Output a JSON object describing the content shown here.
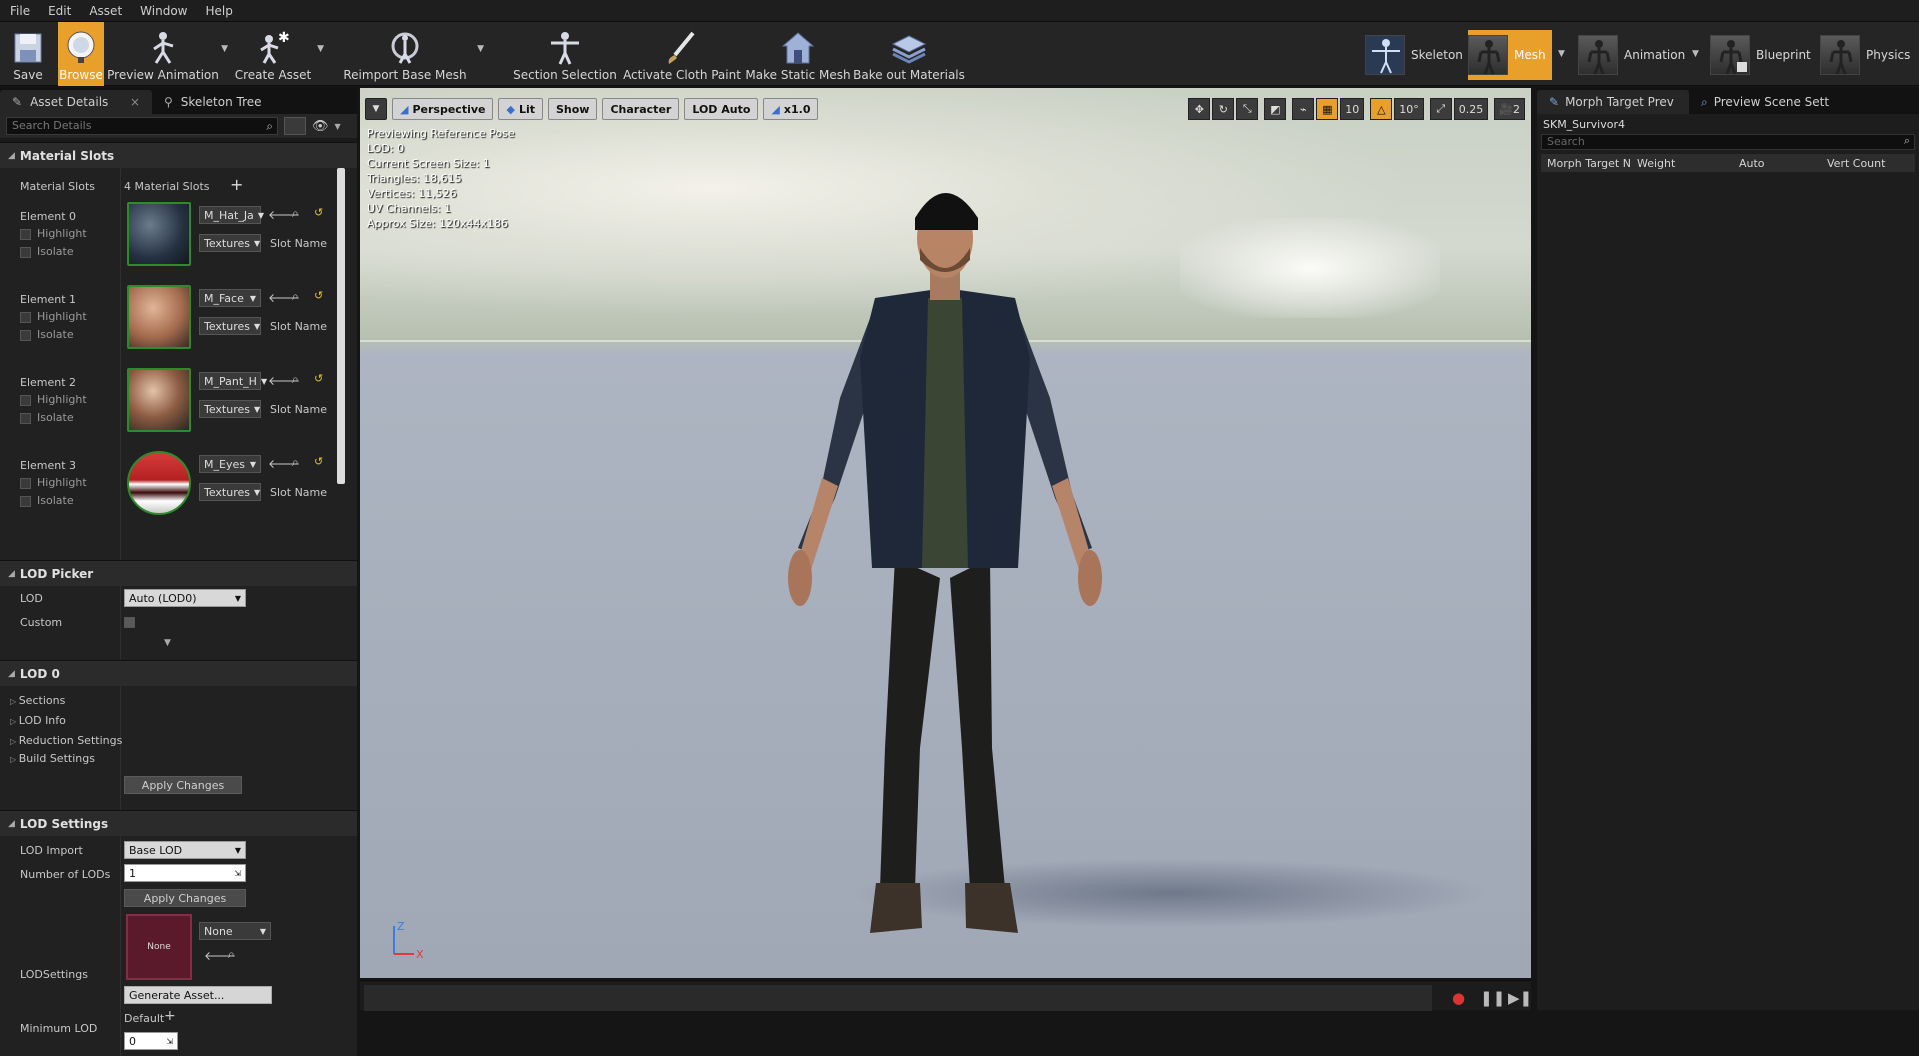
{
  "menu": [
    "File",
    "Edit",
    "Asset",
    "Window",
    "Help"
  ],
  "toolbar": {
    "save": "Save",
    "browse": "Browse",
    "preview_animation": "Preview Animation",
    "create_asset": "Create Asset",
    "reimport": "Reimport Base Mesh",
    "section_selection": "Section Selection",
    "activate_cloth": "Activate Cloth Paint",
    "make_static": "Make Static Mesh",
    "bake_materials": "Bake out Materials"
  },
  "modes": {
    "skeleton": "Skeleton",
    "mesh": "Mesh",
    "animation": "Animation",
    "blueprint": "Blueprint",
    "physics": "Physics"
  },
  "left": {
    "tabs": {
      "asset_details": "Asset Details",
      "skeleton_tree": "Skeleton Tree"
    },
    "search_placeholder": "Search Details",
    "material_slots_header": "Material Slots",
    "material_slots_label": "Material Slots",
    "material_slots_count": "4 Material Slots",
    "elements": [
      {
        "name": "Element 0",
        "material": "M_Hat_Ja",
        "textures": "Textures",
        "slot": "Slot Name"
      },
      {
        "name": "Element 1",
        "material": "M_Face",
        "textures": "Textures",
        "slot": "Slot Name"
      },
      {
        "name": "Element 2",
        "material": "M_Pant_H",
        "textures": "Textures",
        "slot": "Slot Name"
      },
      {
        "name": "Element 3",
        "material": "M_Eyes",
        "textures": "Textures",
        "slot": "Slot Name"
      }
    ],
    "highlight": "Highlight",
    "isolate": "Isolate",
    "lod_picker_header": "LOD Picker",
    "lod_label": "LOD",
    "lod_value": "Auto (LOD0)",
    "custom_label": "Custom",
    "lod0_header": "LOD 0",
    "lod0_items": [
      "Sections",
      "LOD Info",
      "Reduction Settings",
      "Build Settings"
    ],
    "apply_changes": "Apply Changes",
    "lod_settings_header": "LOD Settings",
    "lod_import_label": "LOD Import",
    "lod_import_value": "Base LOD",
    "num_lods_label": "Number of LODs",
    "num_lods_value": "1",
    "lodsettings_label": "LODSettings",
    "lodsettings_thumb": "None",
    "lodsettings_value": "None",
    "generate_asset": "Generate Asset...",
    "min_lod_label": "Minimum LOD",
    "min_lod_default": "Default",
    "min_lod_value": "0"
  },
  "viewport": {
    "buttons": {
      "perspective": "Perspective",
      "lit": "Lit",
      "show": "Show",
      "character": "Character",
      "lod": "LOD Auto",
      "speed": "x1.0"
    },
    "right": {
      "grid": "10",
      "angle": "10°",
      "scale": "0.25",
      "cam": "2"
    },
    "info": [
      "Previewing Reference Pose",
      "LOD: 0",
      "Current Screen Size: 1",
      "Triangles: 18,615",
      "Vertices: 11,526",
      "UV Channels: 1",
      "Approx Size: 120x44x186"
    ],
    "axis_z": "Z",
    "axis_x": "X"
  },
  "right": {
    "tabs": {
      "morph": "Morph Target Prev",
      "scene": "Preview Scene Sett"
    },
    "asset_name": "SKM_Survivor4",
    "search_placeholder": "Search",
    "columns": [
      "Morph Target N",
      "Weight",
      "Auto",
      "Vert Count"
    ]
  },
  "colors": {
    "accent": "#e8a02b",
    "slot_border": "#2c8c2c"
  }
}
